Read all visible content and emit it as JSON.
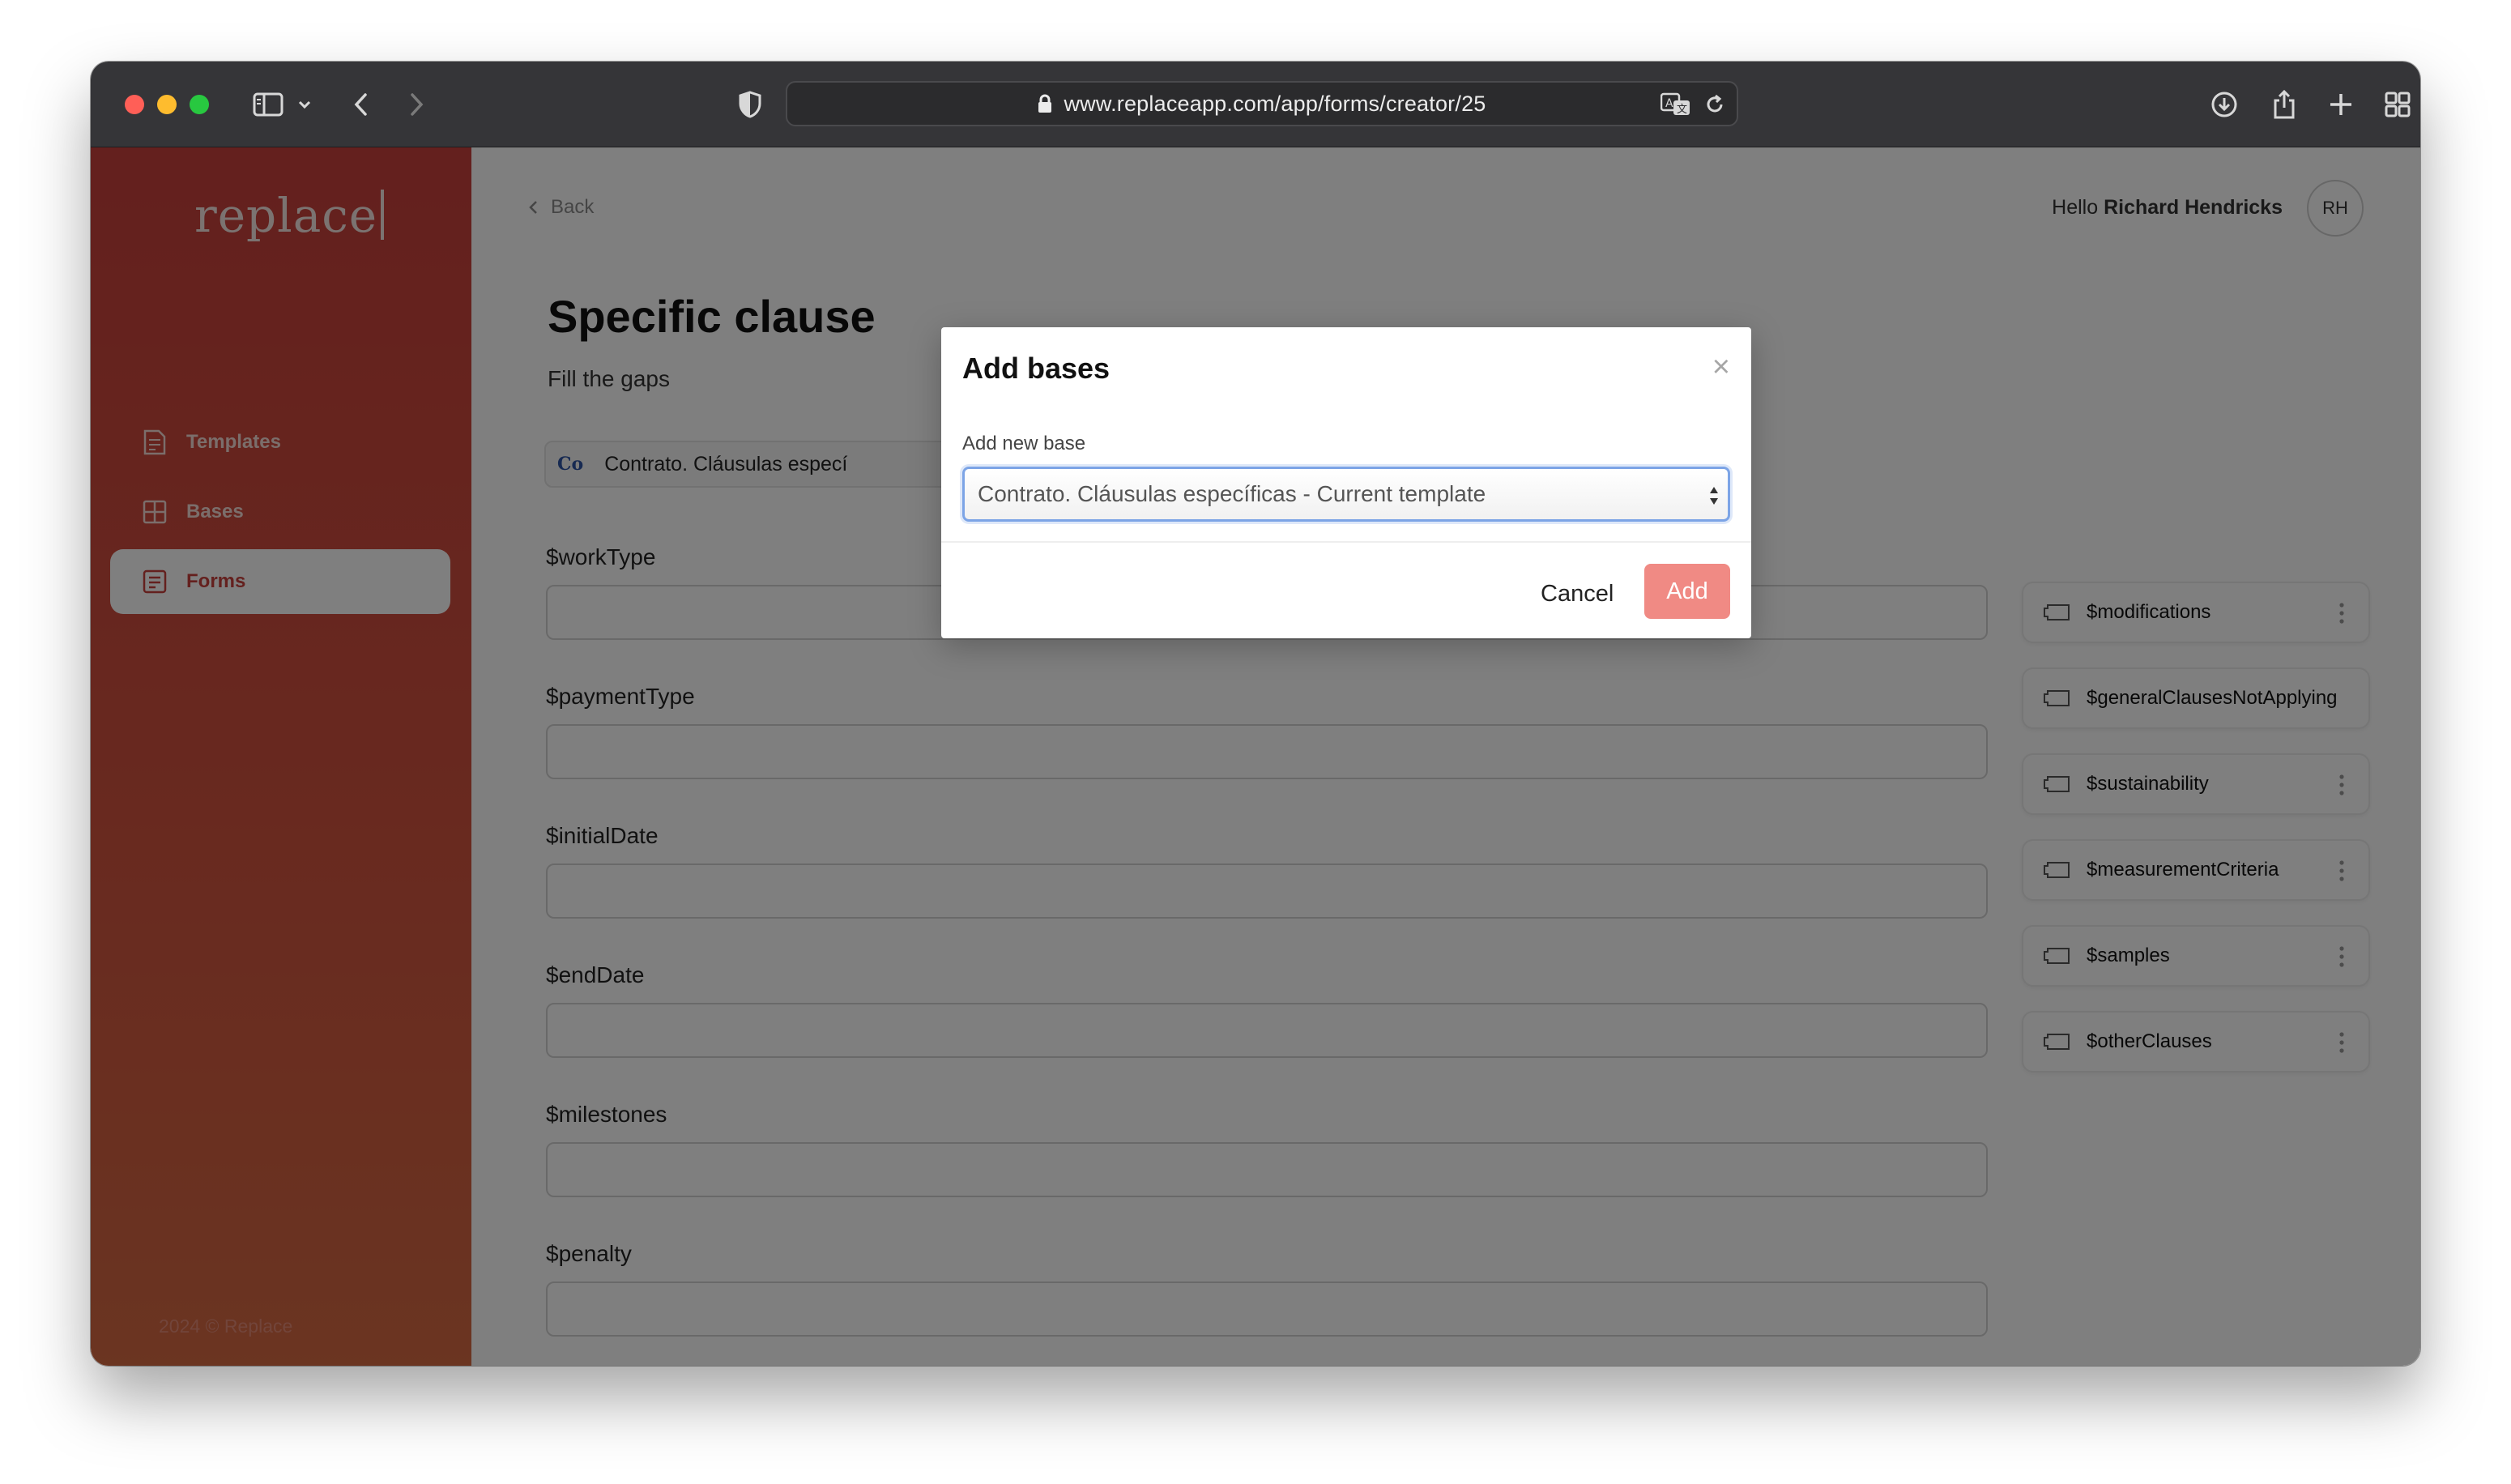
{
  "browser": {
    "url": "www.replaceapp.com/app/forms/creator/25",
    "icons": [
      "sidebar-icon",
      "chevron-down-icon",
      "back-icon",
      "forward-icon",
      "shield-icon",
      "lock-icon",
      "translate-icon",
      "reload-icon",
      "download-icon",
      "share-icon",
      "new-tab-icon",
      "tab-overview-icon"
    ]
  },
  "app": {
    "logo": "replace",
    "nav": [
      {
        "label": "Templates",
        "icon": "document-icon",
        "active": false
      },
      {
        "label": "Bases",
        "icon": "grid-icon",
        "active": false
      },
      {
        "label": "Forms",
        "icon": "form-icon",
        "active": true
      }
    ],
    "copyright": "2024 © Replace",
    "back_label": "Back",
    "greeting_prefix": "Hello ",
    "greeting_name": "Richard Hendricks",
    "avatar_initials": "RH",
    "title": "Specific clause",
    "subtitle": "Fill the gaps",
    "base_chip": {
      "abbr": "Co",
      "text": "Contrato. Cláusulas especí"
    },
    "fields": [
      {
        "label": "$workType",
        "value": ""
      },
      {
        "label": "$paymentType",
        "value": ""
      },
      {
        "label": "$initialDate",
        "value": ""
      },
      {
        "label": "$endDate",
        "value": ""
      },
      {
        "label": "$milestones",
        "value": ""
      },
      {
        "label": "$penalty",
        "value": ""
      }
    ],
    "variables": [
      {
        "name": "$modifications"
      },
      {
        "name": "$generalClausesNotApplying"
      },
      {
        "name": "$sustainability"
      },
      {
        "name": "$measurementCriteria"
      },
      {
        "name": "$samples"
      },
      {
        "name": "$otherClauses"
      }
    ]
  },
  "modal": {
    "title": "Add bases",
    "close": "×",
    "label": "Add new base",
    "select_value": "Contrato. Cláusulas específicas - Current template",
    "cancel": "Cancel",
    "add": "Add"
  },
  "colors": {
    "sidebar": "#c8403c",
    "accent": "#c8403c",
    "add_button": "#f08a84",
    "focus_ring": "#7ca4e6"
  }
}
